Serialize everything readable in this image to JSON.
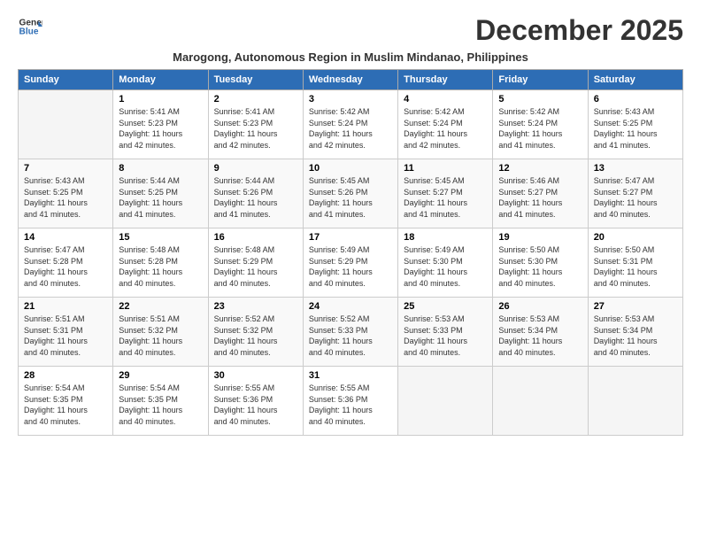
{
  "logo": {
    "line1": "General",
    "line2": "Blue"
  },
  "title": "December 2025",
  "subtitle": "Marogong, Autonomous Region in Muslim Mindanao, Philippines",
  "days_header": [
    "Sunday",
    "Monday",
    "Tuesday",
    "Wednesday",
    "Thursday",
    "Friday",
    "Saturday"
  ],
  "weeks": [
    [
      {
        "num": "",
        "info": ""
      },
      {
        "num": "1",
        "info": "Sunrise: 5:41 AM\nSunset: 5:23 PM\nDaylight: 11 hours\nand 42 minutes."
      },
      {
        "num": "2",
        "info": "Sunrise: 5:41 AM\nSunset: 5:23 PM\nDaylight: 11 hours\nand 42 minutes."
      },
      {
        "num": "3",
        "info": "Sunrise: 5:42 AM\nSunset: 5:24 PM\nDaylight: 11 hours\nand 42 minutes."
      },
      {
        "num": "4",
        "info": "Sunrise: 5:42 AM\nSunset: 5:24 PM\nDaylight: 11 hours\nand 42 minutes."
      },
      {
        "num": "5",
        "info": "Sunrise: 5:42 AM\nSunset: 5:24 PM\nDaylight: 11 hours\nand 41 minutes."
      },
      {
        "num": "6",
        "info": "Sunrise: 5:43 AM\nSunset: 5:25 PM\nDaylight: 11 hours\nand 41 minutes."
      }
    ],
    [
      {
        "num": "7",
        "info": "Sunrise: 5:43 AM\nSunset: 5:25 PM\nDaylight: 11 hours\nand 41 minutes."
      },
      {
        "num": "8",
        "info": "Sunrise: 5:44 AM\nSunset: 5:25 PM\nDaylight: 11 hours\nand 41 minutes."
      },
      {
        "num": "9",
        "info": "Sunrise: 5:44 AM\nSunset: 5:26 PM\nDaylight: 11 hours\nand 41 minutes."
      },
      {
        "num": "10",
        "info": "Sunrise: 5:45 AM\nSunset: 5:26 PM\nDaylight: 11 hours\nand 41 minutes."
      },
      {
        "num": "11",
        "info": "Sunrise: 5:45 AM\nSunset: 5:27 PM\nDaylight: 11 hours\nand 41 minutes."
      },
      {
        "num": "12",
        "info": "Sunrise: 5:46 AM\nSunset: 5:27 PM\nDaylight: 11 hours\nand 41 minutes."
      },
      {
        "num": "13",
        "info": "Sunrise: 5:47 AM\nSunset: 5:27 PM\nDaylight: 11 hours\nand 40 minutes."
      }
    ],
    [
      {
        "num": "14",
        "info": "Sunrise: 5:47 AM\nSunset: 5:28 PM\nDaylight: 11 hours\nand 40 minutes."
      },
      {
        "num": "15",
        "info": "Sunrise: 5:48 AM\nSunset: 5:28 PM\nDaylight: 11 hours\nand 40 minutes."
      },
      {
        "num": "16",
        "info": "Sunrise: 5:48 AM\nSunset: 5:29 PM\nDaylight: 11 hours\nand 40 minutes."
      },
      {
        "num": "17",
        "info": "Sunrise: 5:49 AM\nSunset: 5:29 PM\nDaylight: 11 hours\nand 40 minutes."
      },
      {
        "num": "18",
        "info": "Sunrise: 5:49 AM\nSunset: 5:30 PM\nDaylight: 11 hours\nand 40 minutes."
      },
      {
        "num": "19",
        "info": "Sunrise: 5:50 AM\nSunset: 5:30 PM\nDaylight: 11 hours\nand 40 minutes."
      },
      {
        "num": "20",
        "info": "Sunrise: 5:50 AM\nSunset: 5:31 PM\nDaylight: 11 hours\nand 40 minutes."
      }
    ],
    [
      {
        "num": "21",
        "info": "Sunrise: 5:51 AM\nSunset: 5:31 PM\nDaylight: 11 hours\nand 40 minutes."
      },
      {
        "num": "22",
        "info": "Sunrise: 5:51 AM\nSunset: 5:32 PM\nDaylight: 11 hours\nand 40 minutes."
      },
      {
        "num": "23",
        "info": "Sunrise: 5:52 AM\nSunset: 5:32 PM\nDaylight: 11 hours\nand 40 minutes."
      },
      {
        "num": "24",
        "info": "Sunrise: 5:52 AM\nSunset: 5:33 PM\nDaylight: 11 hours\nand 40 minutes."
      },
      {
        "num": "25",
        "info": "Sunrise: 5:53 AM\nSunset: 5:33 PM\nDaylight: 11 hours\nand 40 minutes."
      },
      {
        "num": "26",
        "info": "Sunrise: 5:53 AM\nSunset: 5:34 PM\nDaylight: 11 hours\nand 40 minutes."
      },
      {
        "num": "27",
        "info": "Sunrise: 5:53 AM\nSunset: 5:34 PM\nDaylight: 11 hours\nand 40 minutes."
      }
    ],
    [
      {
        "num": "28",
        "info": "Sunrise: 5:54 AM\nSunset: 5:35 PM\nDaylight: 11 hours\nand 40 minutes."
      },
      {
        "num": "29",
        "info": "Sunrise: 5:54 AM\nSunset: 5:35 PM\nDaylight: 11 hours\nand 40 minutes."
      },
      {
        "num": "30",
        "info": "Sunrise: 5:55 AM\nSunset: 5:36 PM\nDaylight: 11 hours\nand 40 minutes."
      },
      {
        "num": "31",
        "info": "Sunrise: 5:55 AM\nSunset: 5:36 PM\nDaylight: 11 hours\nand 40 minutes."
      },
      {
        "num": "",
        "info": ""
      },
      {
        "num": "",
        "info": ""
      },
      {
        "num": "",
        "info": ""
      }
    ]
  ]
}
